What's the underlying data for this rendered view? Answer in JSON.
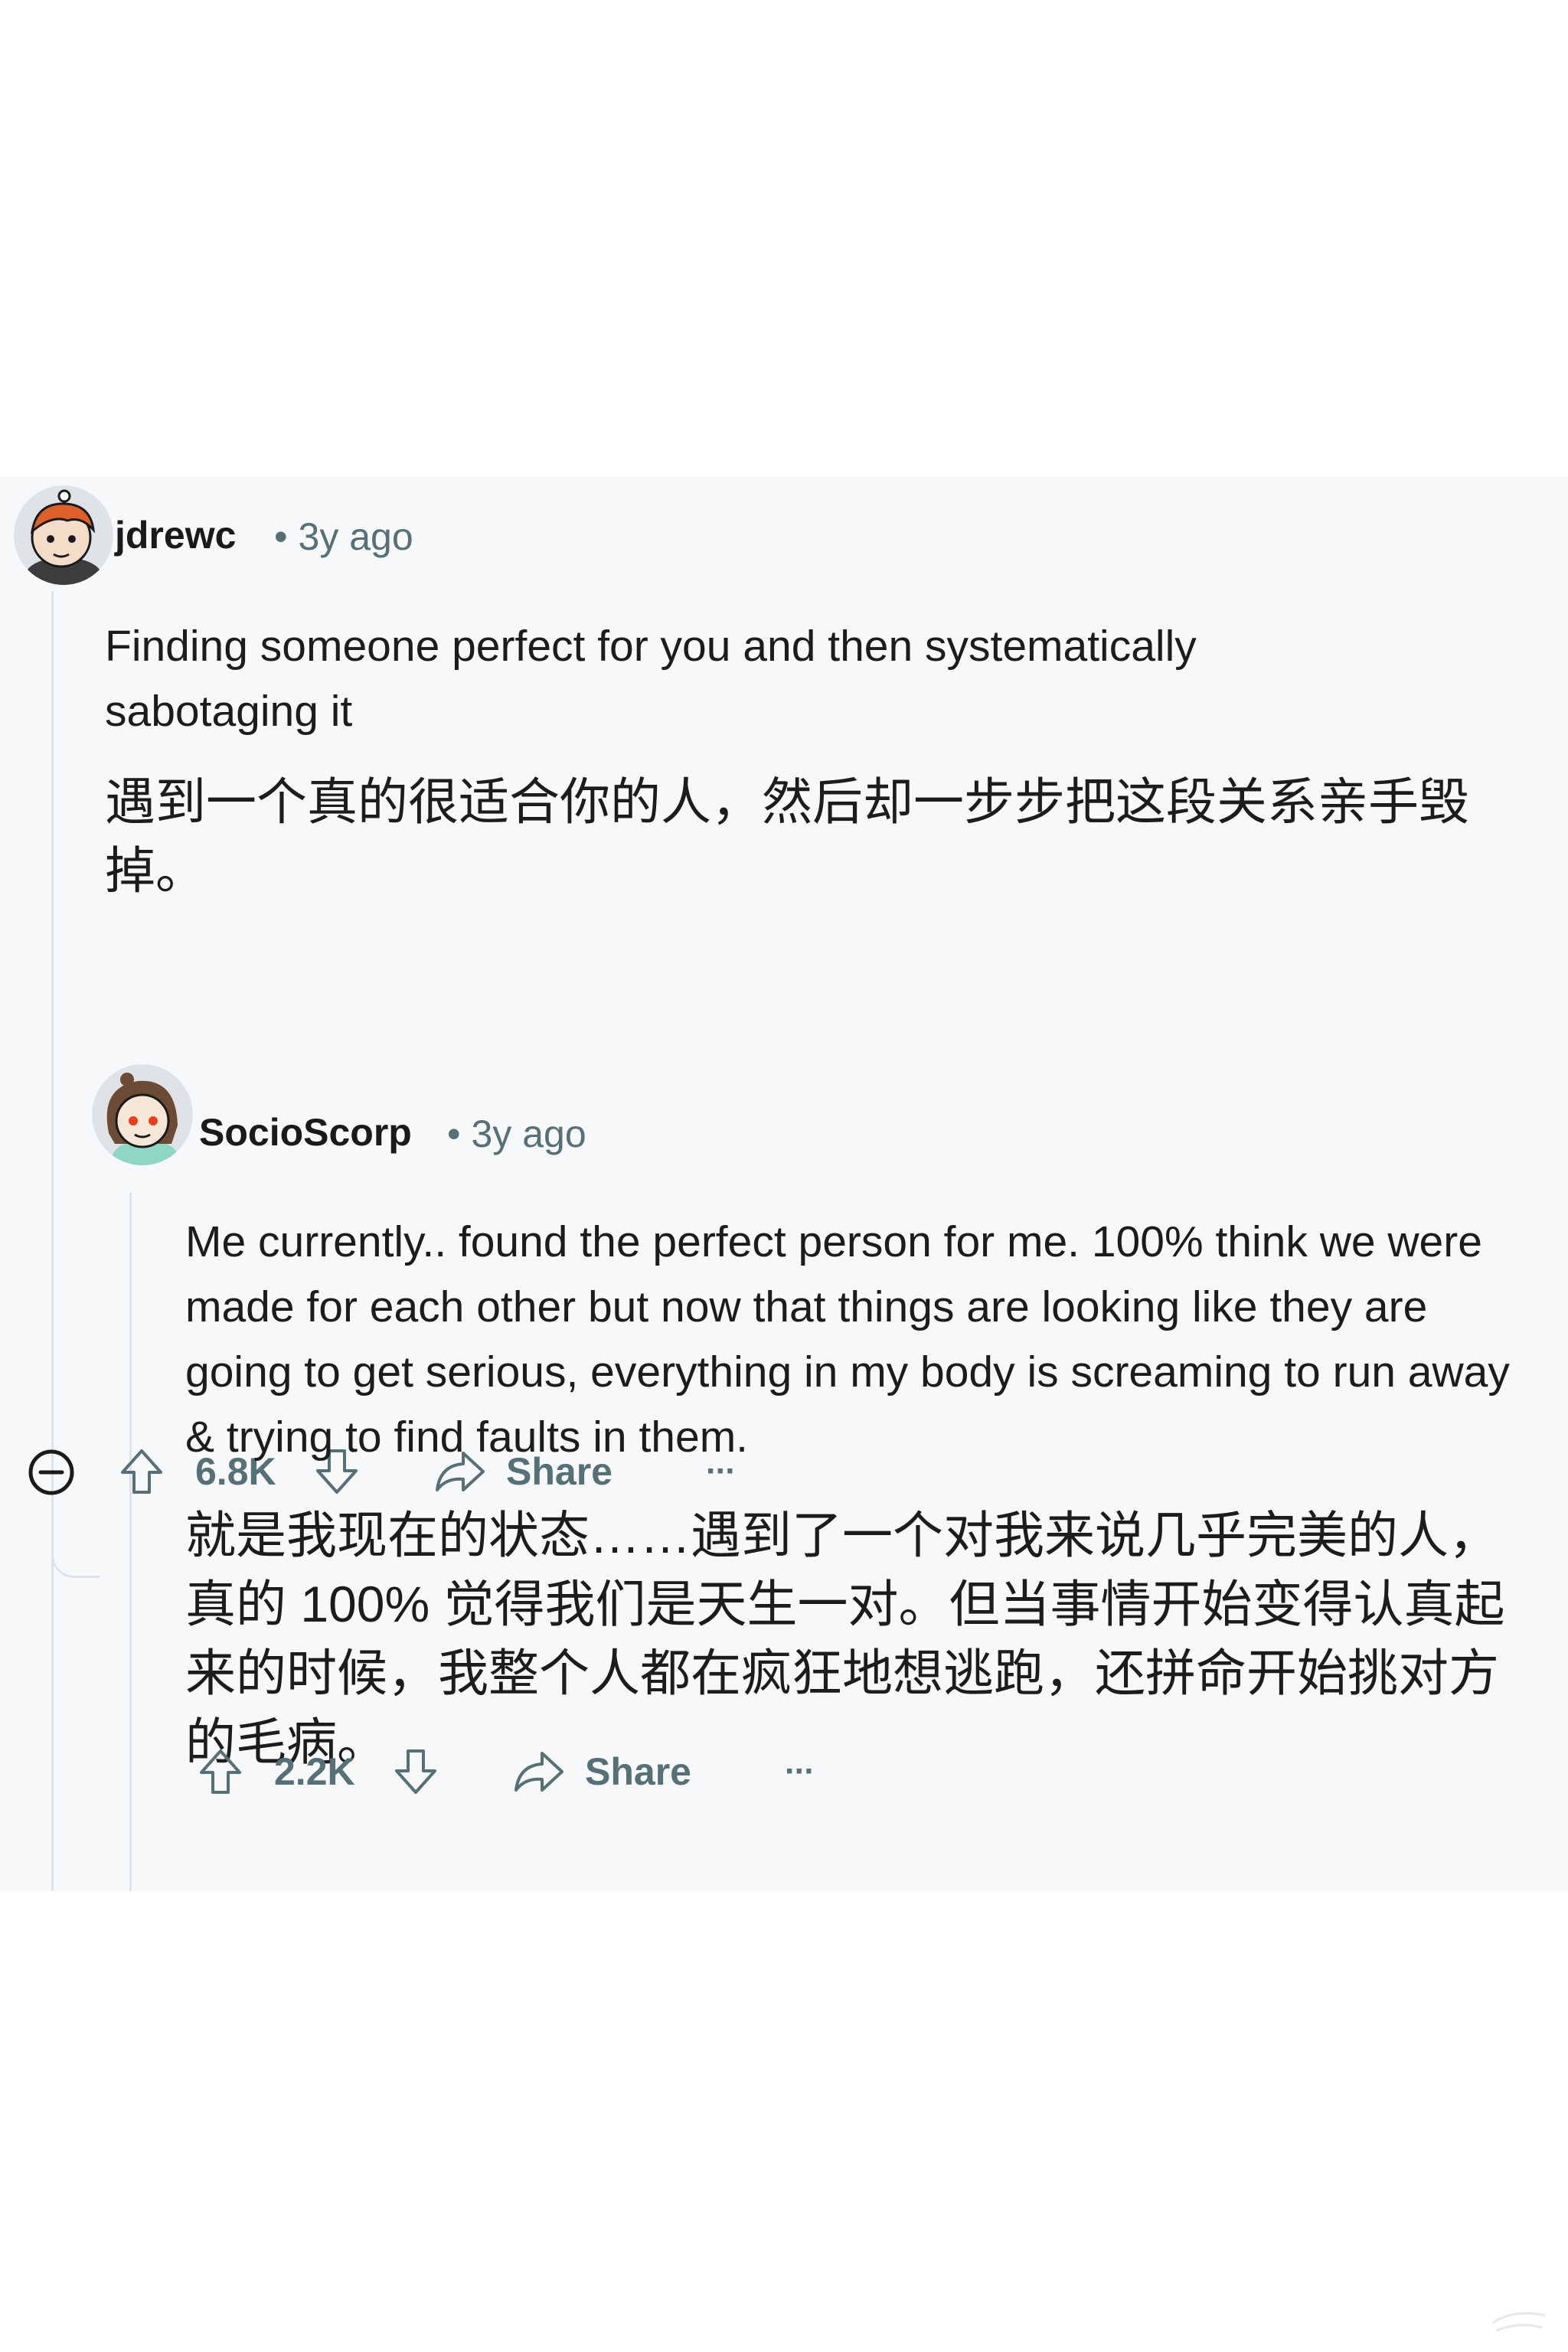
{
  "comments": [
    {
      "author": "jdrewc",
      "time": "3y ago",
      "body_en": "Finding someone perfect for you and then systematically sabotaging it",
      "body_zh": "遇到一个真的很适合你的人，然后却一步步把这段关系亲手毁掉。",
      "score": "6.8K",
      "share_label": "Share",
      "more_label": "···"
    },
    {
      "author": "SocioScorp",
      "time": "3y ago",
      "body_en": "Me currently.. found the perfect person for me. 100% think we were made for each other but now that things are looking like they are going to get serious, everything in my body is screaming to run away & trying to find faults in them.",
      "body_zh": "就是我现在的状态……遇到了一个对我来说几乎完美的人，真的 100% 觉得我们是天生一对。但当事情开始变得认真起来的时候，我整个人都在疯狂地想逃跑，还拼命开始挑对方的毛病。",
      "score": "2.2K",
      "share_label": "Share",
      "more_label": "···"
    }
  ],
  "icons": {
    "collapse": "minus-circle-icon",
    "upvote": "arrow-up-outline-icon",
    "downvote": "arrow-down-outline-icon",
    "share": "share-arrow-icon",
    "more": "ellipsis-icon"
  },
  "colors": {
    "panel_bg": "#f7f8fa",
    "text": "#1c1c1c",
    "meta": "#576f76",
    "thread_line": "#dfe3e8"
  }
}
